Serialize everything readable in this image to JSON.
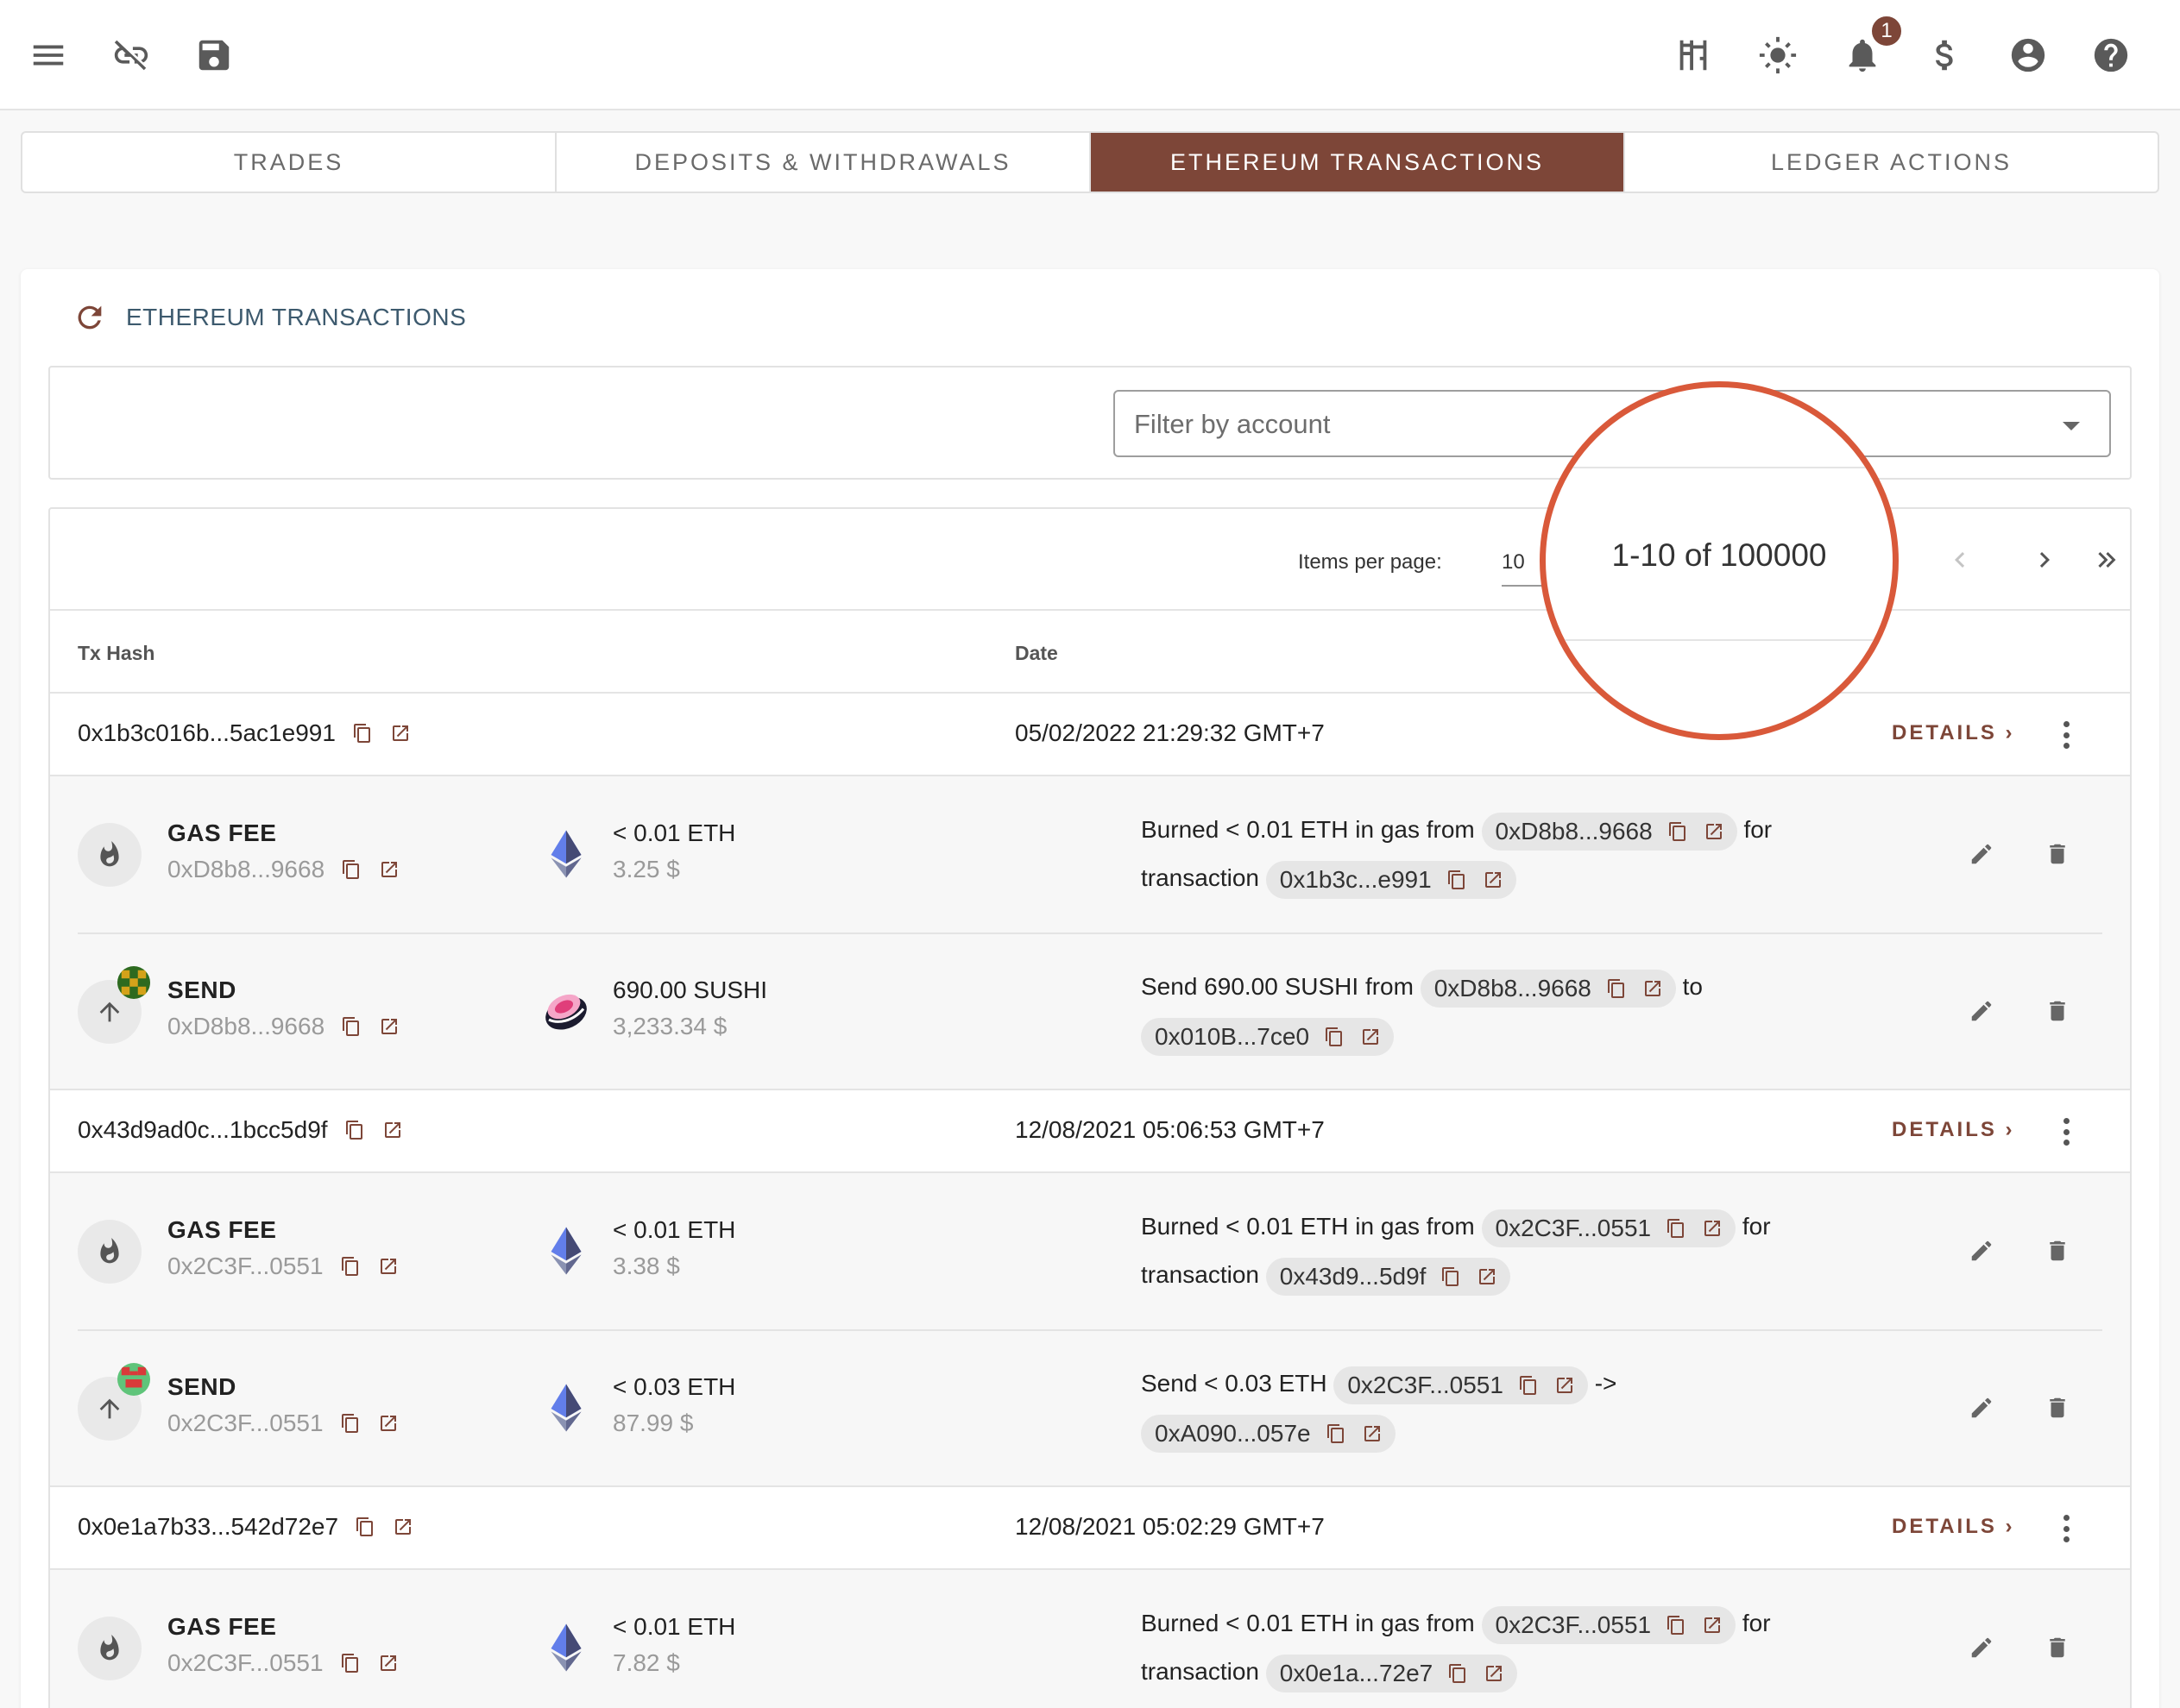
{
  "notifications": {
    "count": "1"
  },
  "tabs": [
    {
      "label": "TRADES"
    },
    {
      "label": "DEPOSITS & WITHDRAWALS"
    },
    {
      "label": "ETHEREUM TRANSACTIONS"
    },
    {
      "label": "LEDGER ACTIONS"
    }
  ],
  "card": {
    "title": "ETHEREUM TRANSACTIONS"
  },
  "filter": {
    "placeholder": "Filter by account"
  },
  "pager": {
    "items_per_page_label": "Items per page:",
    "items_per_page": "10",
    "range": "1-10 of 100000"
  },
  "columns": {
    "tx_hash": "Tx Hash",
    "date": "Date"
  },
  "details_label": "DETAILS",
  "transactions": [
    {
      "hash": "0x1b3c016b...5ac1e991",
      "date": "05/02/2022 21:29:32 GMT+7",
      "events": [
        {
          "type": "GAS FEE",
          "address": "0xD8b8...9668",
          "amount": "< 0.01 ETH",
          "usd": "3.25 $",
          "desc": {
            "p1": "Burned < 0.01 ETH in gas from",
            "chip1": "0xD8b8...9668",
            "p2": "for",
            "p3": "transaction",
            "chip2": "0x1b3c...e991"
          }
        },
        {
          "type": "SEND",
          "address": "0xD8b8...9668",
          "amount": "690.00 SUSHI",
          "usd": "3,233.34 $",
          "desc": {
            "p1": "Send 690.00 SUSHI from",
            "chip1": "0xD8b8...9668",
            "p2": "to",
            "chip2": "0x010B...7ce0"
          }
        }
      ]
    },
    {
      "hash": "0x43d9ad0c...1bcc5d9f",
      "date": "12/08/2021 05:06:53 GMT+7",
      "events": [
        {
          "type": "GAS FEE",
          "address": "0x2C3F...0551",
          "amount": "< 0.01 ETH",
          "usd": "3.38 $",
          "desc": {
            "p1": "Burned < 0.01 ETH in gas from",
            "chip1": "0x2C3F...0551",
            "p2": "for",
            "p3": "transaction",
            "chip2": "0x43d9...5d9f"
          }
        },
        {
          "type": "SEND",
          "address": "0x2C3F...0551",
          "amount": "< 0.03 ETH",
          "usd": "87.99 $",
          "desc": {
            "p1": "Send < 0.03 ETH",
            "chip1": "0x2C3F...0551",
            "p2": "->",
            "chip2": "0xA090...057e"
          }
        }
      ]
    },
    {
      "hash": "0x0e1a7b33...542d72e7",
      "date": "12/08/2021 05:02:29 GMT+7",
      "events": [
        {
          "type": "GAS FEE",
          "address": "0x2C3F...0551",
          "amount": "< 0.01 ETH",
          "usd": "7.82 $",
          "desc": {
            "p1": "Burned < 0.01 ETH in gas from",
            "chip1": "0x2C3F...0551",
            "p2": "for",
            "p3": "transaction",
            "chip2": "0x0e1a...72e7"
          }
        }
      ]
    }
  ],
  "icons": {
    "topbar_left": [
      "menu-icon",
      "link-off-icon",
      "save-icon"
    ],
    "topbar_right": [
      "playground-icon",
      "brightness-icon",
      "bell-icon",
      "currency-dollar-icon",
      "account-circle-icon",
      "help-icon"
    ]
  },
  "colors": {
    "accent": "#7d4638",
    "annotation": "#d9593a",
    "title": "#3d5a6e"
  }
}
